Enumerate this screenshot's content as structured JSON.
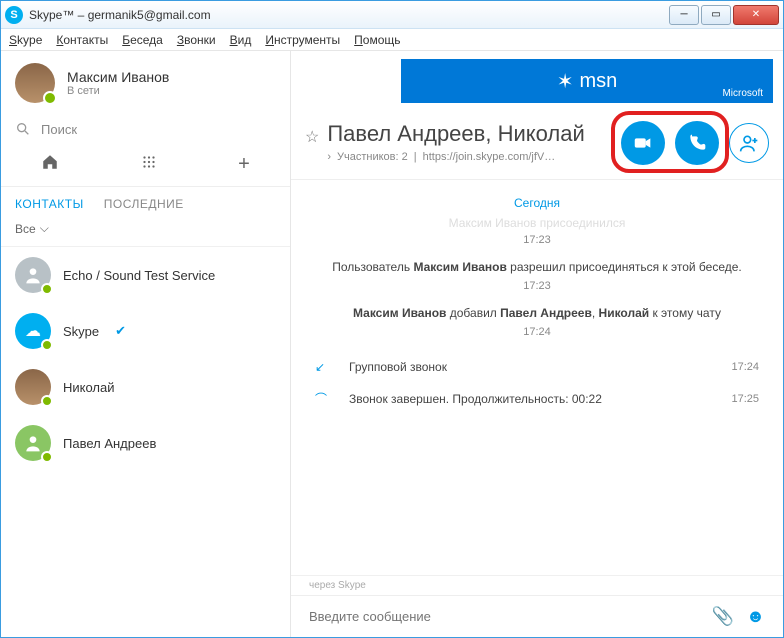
{
  "window": {
    "title": "Skype™ – germanik5@gmail.com"
  },
  "menu": [
    "Skype",
    "Контакты",
    "Беседа",
    "Звонки",
    "Вид",
    "Инструменты",
    "Помощь"
  ],
  "profile": {
    "name": "Максим Иванов",
    "status": "В сети"
  },
  "search": {
    "placeholder": "Поиск"
  },
  "tabs": {
    "contacts": "КОНТАКТЫ",
    "recent": "ПОСЛЕДНИЕ"
  },
  "filter": {
    "label": "Все"
  },
  "contacts": [
    {
      "name": "Echo / Sound Test Service"
    },
    {
      "name": "Skype"
    },
    {
      "name": "Николай"
    },
    {
      "name": "Павел Андреев"
    }
  ],
  "banner": {
    "brand": "msn",
    "company": "Microsoft"
  },
  "chat": {
    "title": "Павел Андреев, Николай",
    "participants_label": "Участников: 2",
    "link": "https://join.skype.com/jfV…",
    "day": "Сегодня",
    "faded_line": "Максим Иванов присоединился",
    "t1": "17:23",
    "sys1_pre": "Пользователь ",
    "sys1_name": "Максим Иванов",
    "sys1_post": " разрешил присоединяться к этой беседе.",
    "t2": "17:23",
    "sys2_name1": "Максим Иванов",
    "sys2_mid": " добавил ",
    "sys2_name2": "Павел Андреев",
    "sys2_sep": ", ",
    "sys2_name3": "Николай",
    "sys2_post": " к этому чату",
    "t3": "17:24",
    "call1": "Групповой звонок",
    "call1_time": "17:24",
    "call2": "Звонок завершен. Продолжительность: 00:22",
    "call2_time": "17:25",
    "via": "через Skype"
  },
  "composer": {
    "placeholder": "Введите сообщение"
  }
}
